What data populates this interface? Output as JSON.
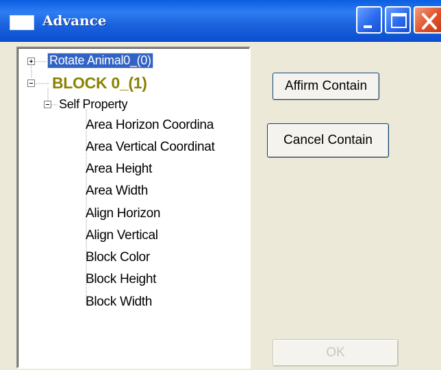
{
  "window": {
    "title": "Advance"
  },
  "tree": {
    "root": {
      "label": "Rotate Animal0_(0)"
    },
    "block": {
      "label": "BLOCK 0_(1)"
    },
    "group": {
      "label": "Self Property"
    },
    "properties": [
      "Area Horizon Coordina",
      "Area Vertical Coordinat",
      "Area Height",
      "Area Width",
      "Align Horizon",
      "Align Vertical",
      "Block Color",
      "Block Height",
      "Block Width"
    ]
  },
  "buttons": {
    "affirm": "Affirm Contain",
    "cancel": "Cancel Contain",
    "ok": "OK"
  },
  "colors": {
    "titlebar": "#0a5ee0",
    "selection": "#3163c5",
    "block_text": "#8c8200",
    "dialog_bg": "#ece9d8"
  }
}
